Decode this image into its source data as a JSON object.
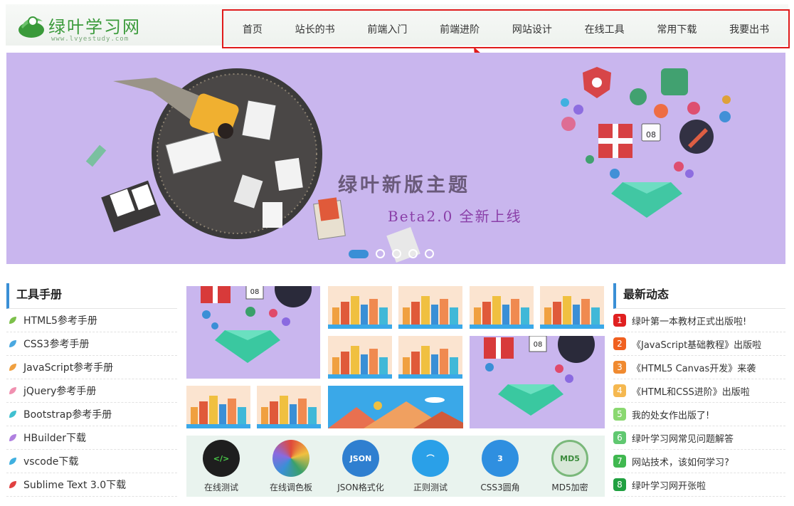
{
  "header": {
    "logo_text": "绿叶学习网",
    "logo_url": "www.lvyestudy.com",
    "nav": [
      "首页",
      "站长的书",
      "前端入门",
      "前端进阶",
      "网站设计",
      "在线工具",
      "常用下载",
      "我要出书"
    ]
  },
  "banner": {
    "title": "绿叶新版主题",
    "subtitle": "Beta2.0 全新上线",
    "slides": 5,
    "active_slide": 1,
    "background": "#c9b6ee",
    "heart_badge": "08"
  },
  "tools_manual": {
    "title": "工具手册",
    "items": [
      {
        "label": "HTML5参考手册",
        "color": "#7cc04a"
      },
      {
        "label": "CSS3参考手册",
        "color": "#4aa8e0"
      },
      {
        "label": "JavaScript参考手册",
        "color": "#f0a040"
      },
      {
        "label": "jQuery参考手册",
        "color": "#f090b0"
      },
      {
        "label": "Bootstrap参考手册",
        "color": "#40c0d0"
      },
      {
        "label": "HBuilder下载",
        "color": "#b080e0"
      },
      {
        "label": "vscode下载",
        "color": "#40b0e0"
      },
      {
        "label": "Sublime Text 3.0下载",
        "color": "#e04040"
      }
    ]
  },
  "tiles": {
    "badge": "08"
  },
  "tools": [
    {
      "label": "在线测试",
      "icon": "run-code-icon",
      "color": "#1e1e1e",
      "text": "</>"
    },
    {
      "label": "在线调色板",
      "icon": "palette-icon",
      "color": "#e04a3a",
      "text": ""
    },
    {
      "label": "JSON格式化",
      "icon": "json-hammer-icon",
      "color": "#2f7fd0",
      "text": "JSON"
    },
    {
      "label": "正则测试",
      "icon": "regex-icon",
      "color": "#2aa0e8",
      "text": "⌒"
    },
    {
      "label": "CSS3圆角",
      "icon": "css3-icon",
      "color": "#2f8fe0",
      "text": "3"
    },
    {
      "label": "MD5加密",
      "icon": "md5-lock-icon",
      "color": "#d8e8d8",
      "text": "MD5"
    }
  ],
  "news": {
    "title": "最新动态",
    "items": [
      {
        "num": "1",
        "label": "绿叶第一本教材正式出版啦!",
        "color": "#e02020"
      },
      {
        "num": "2",
        "label": "《JavaScript基础教程》出版啦",
        "color": "#f06020"
      },
      {
        "num": "3",
        "label": "《HTML5 Canvas开发》来袭",
        "color": "#f08a30"
      },
      {
        "num": "4",
        "label": "《HTML和CSS进阶》出版啦",
        "color": "#f5b850"
      },
      {
        "num": "5",
        "label": "我的处女作出版了!",
        "color": "#8ad870"
      },
      {
        "num": "6",
        "label": "绿叶学习网常见问题解答",
        "color": "#60c870"
      },
      {
        "num": "7",
        "label": "网站技术，该如何学习?",
        "color": "#40b850"
      },
      {
        "num": "8",
        "label": "绿叶学习网开张啦",
        "color": "#20a040"
      }
    ]
  }
}
